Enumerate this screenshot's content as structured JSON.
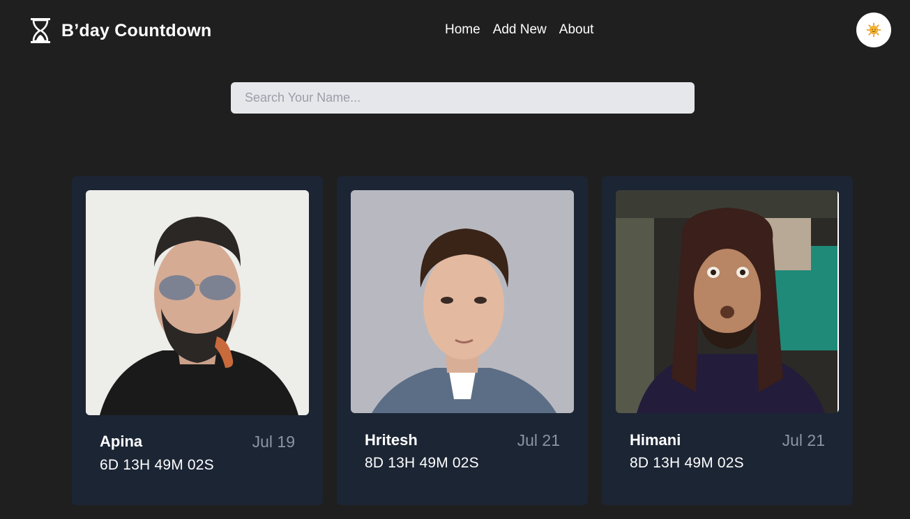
{
  "app": {
    "title": "B’day Countdown"
  },
  "nav": {
    "items": [
      {
        "label": "Home"
      },
      {
        "label": "Add New"
      },
      {
        "label": "About"
      }
    ]
  },
  "theme_toggle": {
    "icon": "sun-icon",
    "icon_color": "#f5b82e"
  },
  "search": {
    "placeholder": "Search Your Name..."
  },
  "cards": [
    {
      "name": "Apina",
      "date": "Jul 19",
      "countdown": "6D 13H 49M 02S",
      "photo": "portrait-photo"
    },
    {
      "name": "Hritesh",
      "date": "Jul 21",
      "countdown": "8D 13H 49M 02S",
      "photo": "portrait-photo"
    },
    {
      "name": "Himani",
      "date": "Jul 21",
      "countdown": "8D 13H 49M 02S",
      "photo": "portrait-photo"
    }
  ],
  "colors": {
    "background": "#1f1f1f",
    "card": "#1c2534",
    "search_bg": "#e6e7eb",
    "date_text": "#8d94a1"
  }
}
